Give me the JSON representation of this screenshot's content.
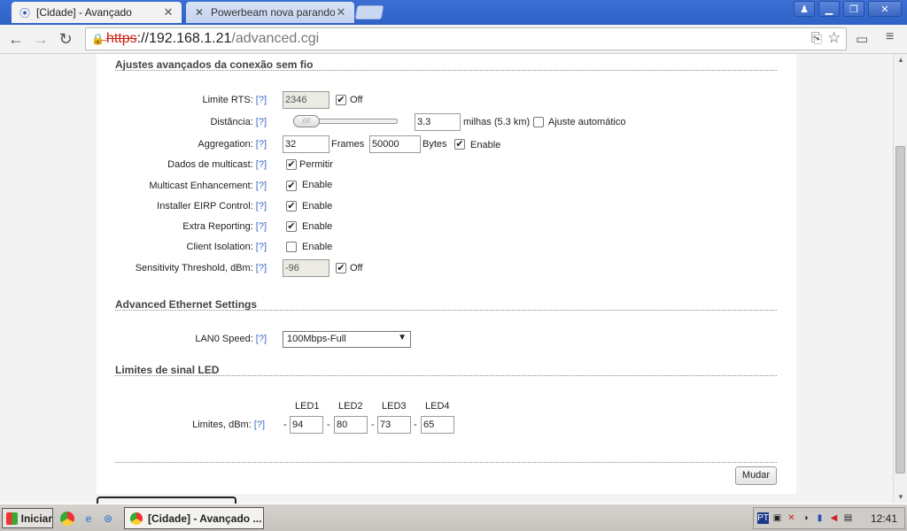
{
  "browser": {
    "tabs": [
      {
        "title": "[Cidade] - Avançado",
        "favicon": "airos-icon"
      },
      {
        "title": "Powerbeam nova parando - F",
        "favicon": "forum-icon"
      }
    ],
    "url": {
      "proto": "https",
      "host": "://192.168.1.21",
      "path": "/advanced.cgi"
    }
  },
  "wireless": {
    "section_title": "Ajustes avançados da conexão sem fio",
    "help": "[?]",
    "rts": {
      "label": "Limite RTS:",
      "value": "2346",
      "off_label": "Off",
      "off_checked": true
    },
    "distance": {
      "label": "Distância:",
      "value": "3.3",
      "units": "milhas (5.3 km)",
      "auto_label": "Ajuste automático",
      "auto_checked": false,
      "slider_level": 0.0
    },
    "aggregation": {
      "label": "Aggregation:",
      "frames_value": "32",
      "frames_label": "Frames",
      "bytes_value": "50000",
      "bytes_label": "Bytes",
      "enable_label": "Enable",
      "enable_checked": true
    },
    "multicast": {
      "label": "Dados de multicast:",
      "option": "Permitir",
      "checked": true
    },
    "multicast_enh": {
      "label": "Multicast Enhancement:",
      "option": "Enable",
      "checked": true
    },
    "eirp": {
      "label": "Installer EIRP Control:",
      "option": "Enable",
      "checked": true
    },
    "extra": {
      "label": "Extra Reporting:",
      "option": "Enable",
      "checked": true
    },
    "isolation": {
      "label": "Client Isolation:",
      "option": "Enable",
      "checked": false
    },
    "sensitivity": {
      "label": "Sensitivity Threshold, dBm:",
      "value": "-96",
      "off_label": "Off",
      "off_checked": true
    }
  },
  "ethernet": {
    "section_title": "Advanced Ethernet Settings",
    "lan0": {
      "label": "LAN0 Speed:",
      "value": "100Mbps-Full"
    }
  },
  "led": {
    "section_title": "Limites de sinal LED",
    "headers": [
      "LED1",
      "LED2",
      "LED3",
      "LED4"
    ],
    "label": "Limites, dBm:",
    "values": [
      "94",
      "80",
      "73",
      "65"
    ],
    "sep": "-"
  },
  "submit_label": "Mudar",
  "taskbar": {
    "start_label": "Iniciar",
    "task_title": "[Cidade] - Avançado ...",
    "clock": "12:41"
  }
}
